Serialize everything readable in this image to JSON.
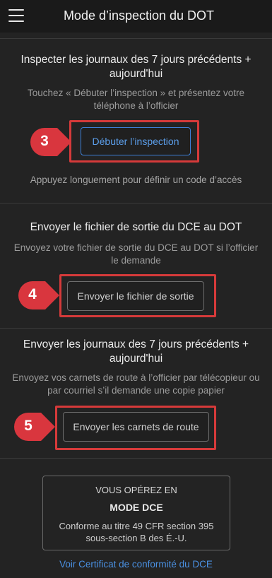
{
  "header": {
    "title": "Mode d’inspection du DOT",
    "menu_icon": "hamburger-menu-icon"
  },
  "sections": [
    {
      "title": "Inspecter les journaux des 7 jours précédents + aujourd'hui",
      "description": "Touchez « Débuter l’inspection » et présentez votre téléphone à l’officier",
      "button_label": "Débuter l’inspection",
      "step": "3",
      "hint": "Appuyez longuement pour définir un code d’accès"
    },
    {
      "title": "Envoyer le fichier de sortie du DCE au DOT",
      "description": "Envoyez votre fichier de sortie du DCE au DOT si l’officier le demande",
      "button_label": "Envoyer le fichier de sortie",
      "step": "4"
    },
    {
      "title": "Envoyer les journaux des 7 jours précédents + aujourd'hui",
      "description": "Envoyez vos carnets de route à l’officier par télécopieur ou par courriel s’il demande une copie papier",
      "button_label": "Envoyer les carnets de route",
      "step": "5"
    }
  ],
  "mode_box": {
    "line1": "VOUS OPÉREZ EN",
    "line2": "MODE DCE",
    "line3": "Conforme au titre 49 CFR section 395 sous-section B des É.-U."
  },
  "link_text": "Voir Certificat de conformité du DCE",
  "colors": {
    "background": "#232323",
    "accent_blue": "#4a90e2",
    "highlight_red": "#d63a3a",
    "marker_red": "#d9363e"
  }
}
